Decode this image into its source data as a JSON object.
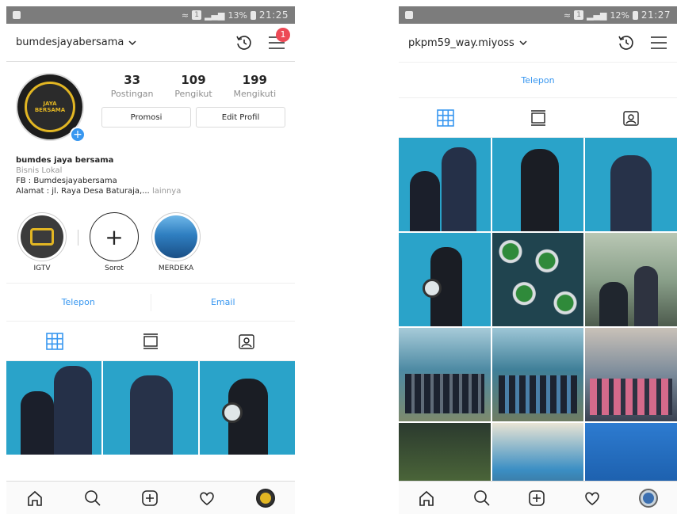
{
  "left": {
    "status": {
      "battery": "13%",
      "time": "21:25",
      "sim": "1"
    },
    "username": "bumdesjayabersama",
    "notification_count": "1",
    "stats": [
      {
        "num": "33",
        "label": "Postingan"
      },
      {
        "num": "109",
        "label": "Pengikut"
      },
      {
        "num": "199",
        "label": "Mengikuti"
      }
    ],
    "buttons": {
      "promote": "Promosi",
      "edit": "Edit Profil"
    },
    "bio": {
      "name": "bumdes jaya bersama",
      "category": "Bisnis Lokal",
      "line1": "FB : Bumdesjayabersama",
      "line2": "Alamat : jl. Raya Desa Baturaja,...",
      "more": "lainnya"
    },
    "avatar_text": {
      "top": "JAYA",
      "bottom": "BERSAMA"
    },
    "highlights": [
      {
        "label": "IGTV"
      },
      {
        "label": "Sorot"
      },
      {
        "label": "MERDEKA"
      }
    ],
    "contact": {
      "phone": "Telepon",
      "email": "Email"
    }
  },
  "right": {
    "status": {
      "battery": "12%",
      "time": "21:27",
      "sim": "1"
    },
    "username": "pkpm59_way.miyoss",
    "contact": {
      "phone": "Telepon"
    }
  },
  "colors": {
    "accent": "#3897f0",
    "badge": "#ed4956",
    "statusbar": "#7c7c7c"
  }
}
